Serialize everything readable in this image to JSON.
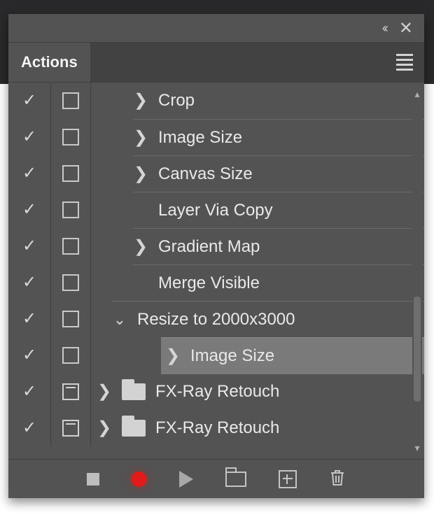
{
  "panel": {
    "title": "Actions"
  },
  "rows": [
    {
      "label": "Crop",
      "depth": 1,
      "arrow": "closed",
      "selected": false,
      "folder": false
    },
    {
      "label": "Image Size",
      "depth": 1,
      "arrow": "closed",
      "selected": false,
      "folder": false
    },
    {
      "label": "Canvas Size",
      "depth": 1,
      "arrow": "closed",
      "selected": false,
      "folder": false
    },
    {
      "label": "Layer Via Copy",
      "depth": 1,
      "arrow": "none",
      "selected": false,
      "folder": false
    },
    {
      "label": "Gradient Map",
      "depth": 1,
      "arrow": "closed",
      "selected": false,
      "folder": false
    },
    {
      "label": "Merge Visible",
      "depth": 1,
      "arrow": "none",
      "selected": false,
      "folder": false
    },
    {
      "label": "Resize to 2000x3000",
      "depth": 0,
      "arrow": "open",
      "selected": false,
      "folder": false
    },
    {
      "label": "Image Size",
      "depth": 1,
      "arrow": "closed",
      "selected": true,
      "folder": false
    },
    {
      "label": "FX-Ray Retouch",
      "depth": -1,
      "arrow": "closed",
      "selected": false,
      "folder": true
    },
    {
      "label": "FX-Ray Retouch",
      "depth": -1,
      "arrow": "closed",
      "selected": false,
      "folder": true
    }
  ]
}
